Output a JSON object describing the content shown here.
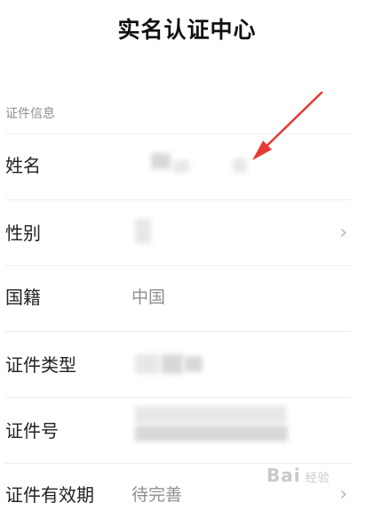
{
  "page_title": "实名认证中心",
  "section_label": "证件信息",
  "rows": [
    {
      "label": "姓名",
      "value": ""
    },
    {
      "label": "性别",
      "value": ""
    },
    {
      "label": "国籍",
      "value": "中国"
    },
    {
      "label": "证件类型",
      "value": ""
    },
    {
      "label": "证件号",
      "value": ""
    },
    {
      "label": "证件有效期",
      "value": "待完善"
    }
  ],
  "watermark": {
    "brand": "Bai",
    "sub": "经验"
  },
  "icons": {
    "chevron": "chevron-right-icon",
    "arrow": "red-annotation-arrow"
  },
  "colors": {
    "annotation": "#e53935",
    "value_text": "#8f8f8f",
    "label_text": "#222222"
  }
}
